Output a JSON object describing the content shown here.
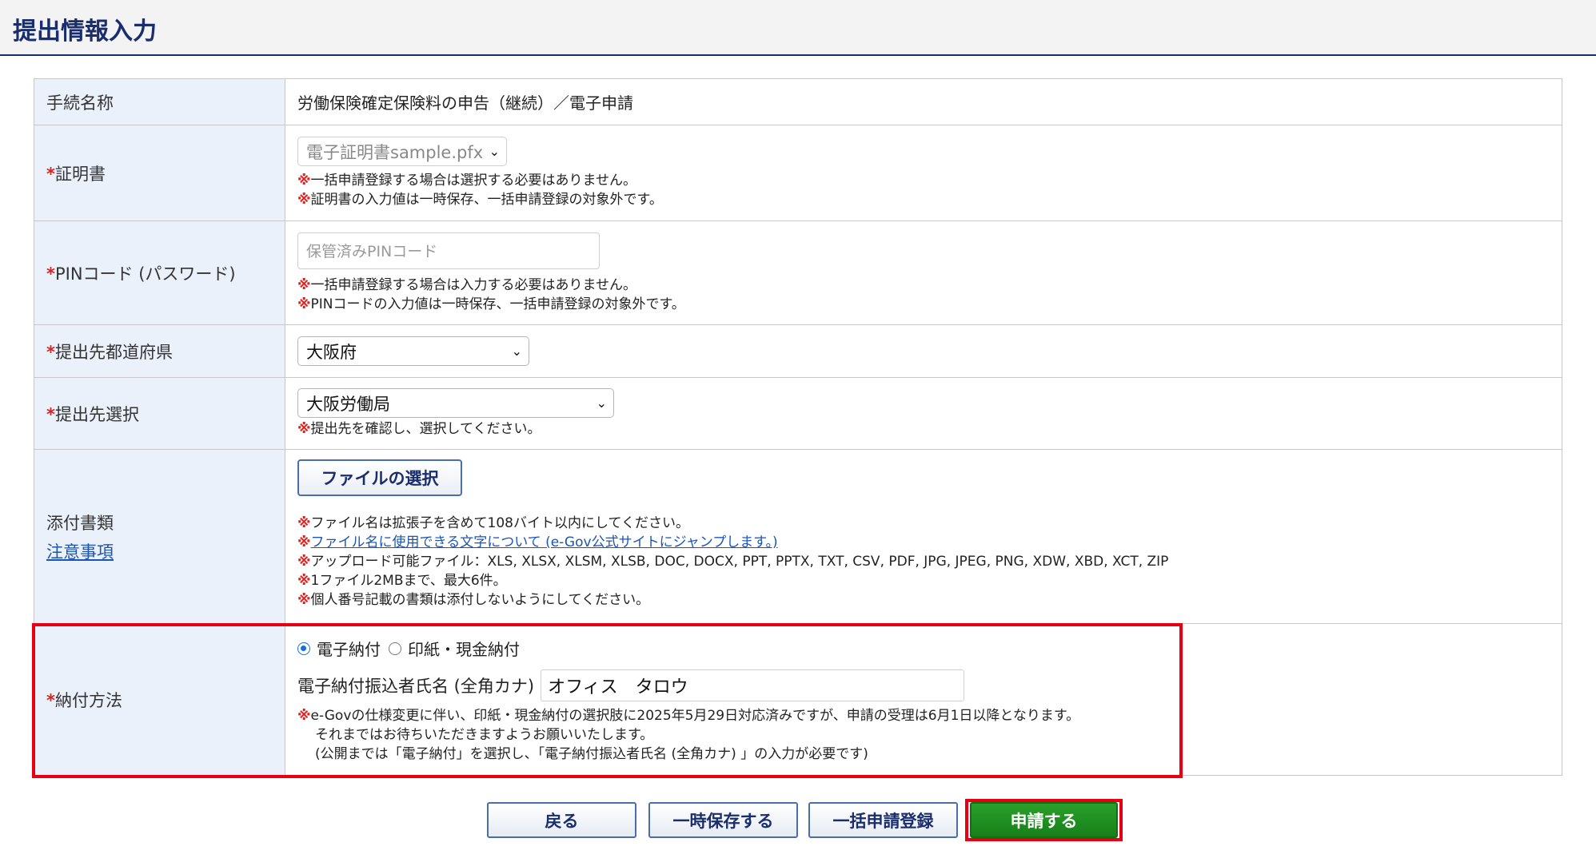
{
  "header": {
    "title": "提出情報入力"
  },
  "required_mark": "*",
  "note_mark": "※",
  "rows": {
    "procedure": {
      "label": "手続名称",
      "value": "労働保険確定保険料の申告（継続）／電子申請"
    },
    "certificate": {
      "label": "証明書",
      "selected": "電子証明書sample.pfx",
      "notes": [
        "一括申請登録する場合は選択する必要はありません。",
        "証明書の入力値は一時保存、一括申請登録の対象外です。"
      ]
    },
    "pin": {
      "label": "PINコード (パスワード)",
      "placeholder": "保管済みPINコード",
      "notes": [
        "一括申請登録する場合は入力する必要はありません。",
        "PINコードの入力値は一時保存、一括申請登録の対象外です。"
      ]
    },
    "prefecture": {
      "label": "提出先都道府県",
      "selected": "大阪府"
    },
    "destination": {
      "label": "提出先選択",
      "selected": "大阪労働局",
      "note": "提出先を確認し、選択してください。"
    },
    "attachments": {
      "label": "添付書類",
      "caution_link": "注意事項",
      "file_button": "ファイルの選択",
      "notes": [
        "ファイル名は拡張子を含めて108バイト以内にしてください。",
        "ファイル名に使用できる文字について (e-Gov公式サイトにジャンプします。)",
        "アップロード可能ファイル：XLS, XLSX, XLSM, XLSB, DOC, DOCX, PPT, PPTX, TXT, CSV, PDF, JPG, JPEG, PNG, XDW, XBD, XCT, ZIP",
        "1ファイル2MBまで、最大6件。",
        "個人番号記載の書類は添付しないようにしてください。"
      ]
    },
    "payment": {
      "label": "納付方法",
      "option_electronic": "電子納付",
      "option_stamp": "印紙・現金納付",
      "selected": "電子納付",
      "payer_label": "電子納付振込者氏名 (全角カナ)",
      "payer_value": "オフィス　タロウ",
      "notes": [
        "e-Govの仕様変更に伴い、印紙・現金納付の選択肢に2025年5月29日対応済みですが、申請の受理は6月1日以降となります。",
        "それまではお待ちいただきますようお願いいたします。",
        "(公開までは「電子納付」を選択し、「電子納付振込者氏名 (全角カナ) 」の入力が必要です)"
      ]
    }
  },
  "buttons": {
    "back": "戻る",
    "temp_save": "一時保存する",
    "bulk_register": "一括申請登録",
    "apply": "申請する"
  },
  "colors": {
    "title": "#1a2e6e",
    "label_bg": "#eaf1fb",
    "required": "#e0201b",
    "highlight": "#e60012",
    "apply_bg": "#1f8f1f",
    "link": "#1a55b5"
  }
}
